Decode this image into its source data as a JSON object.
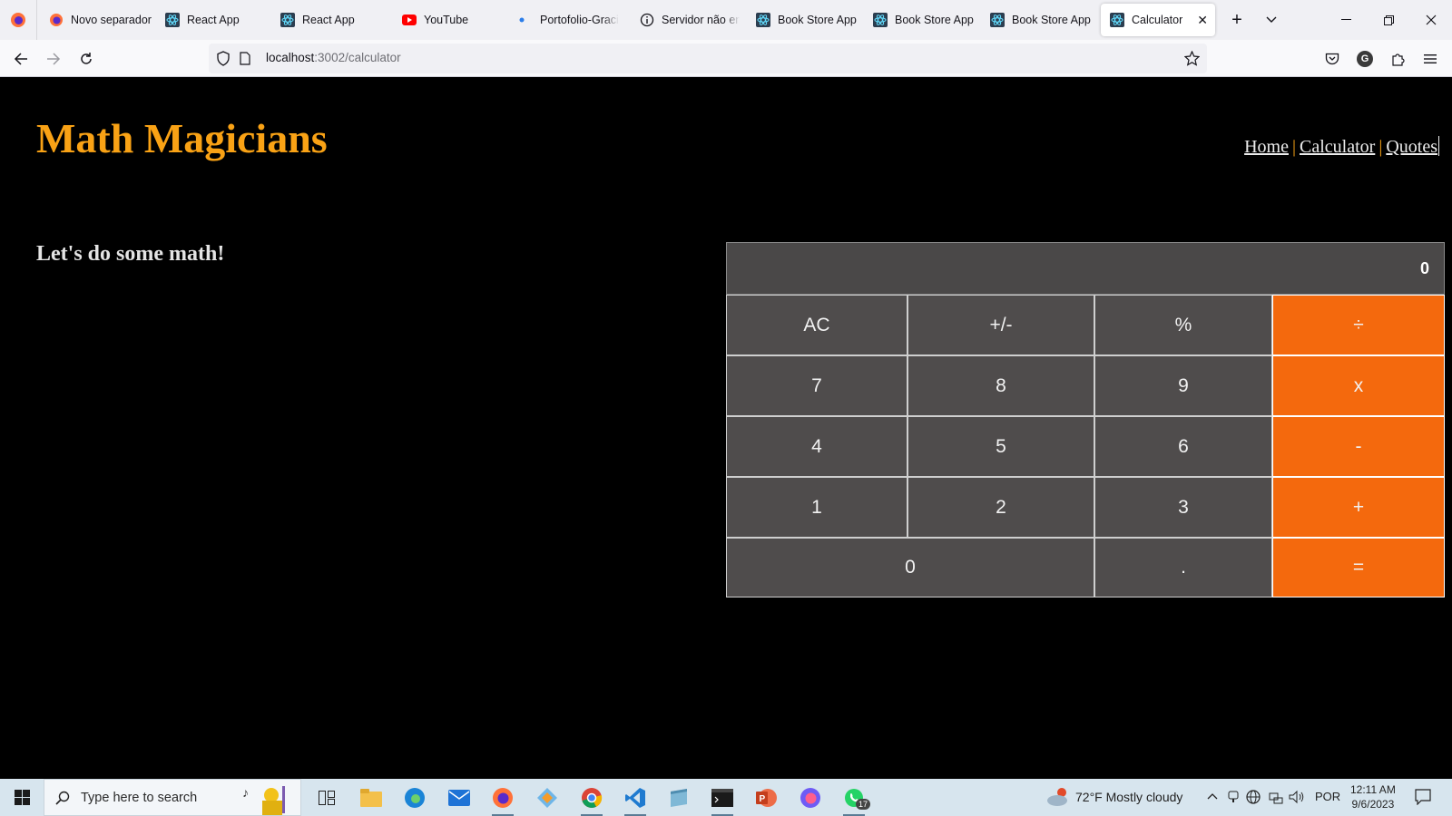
{
  "browser": {
    "tabs": [
      {
        "label": "Novo separador",
        "icon": "firefox-icon"
      },
      {
        "label": "React App",
        "icon": "react-icon"
      },
      {
        "label": "React App",
        "icon": "react-icon"
      },
      {
        "label": "YouTube",
        "icon": "youtube-icon"
      },
      {
        "label": "Portofolio-Graci",
        "icon": "dot-icon"
      },
      {
        "label": "Servidor não enc",
        "icon": "info-icon"
      },
      {
        "label": "Book Store App",
        "icon": "react-icon"
      },
      {
        "label": "Book Store App",
        "icon": "react-icon"
      },
      {
        "label": "Book Store App",
        "icon": "react-icon"
      },
      {
        "label": "Calculator",
        "icon": "react-icon",
        "active": true
      }
    ],
    "url_host": "localhost",
    "url_rest": ":3002/calculator",
    "profile_initial": "G"
  },
  "app": {
    "logo": "Math Magicians",
    "nav": {
      "home": "Home",
      "calculator": "Calculator",
      "quotes": "Quotes",
      "separator": "|"
    },
    "intro": "Let's do some math!",
    "calculator": {
      "display": "0",
      "keys": [
        "AC",
        "+/-",
        "%",
        "÷",
        "7",
        "8",
        "9",
        "x",
        "4",
        "5",
        "6",
        "-",
        "1",
        "2",
        "3",
        "+",
        "0",
        ".",
        "="
      ]
    }
  },
  "taskbar": {
    "search_placeholder": "Type here to search",
    "whatsapp_badge": "17",
    "weather": "72°F  Mostly cloudy",
    "language": "POR",
    "time": "12:11 AM",
    "date": "9/6/2023"
  },
  "colors": {
    "accent": "#f9a215",
    "operator": "#f4690d",
    "key": "#4f4c4c",
    "display": "#4a4848"
  }
}
